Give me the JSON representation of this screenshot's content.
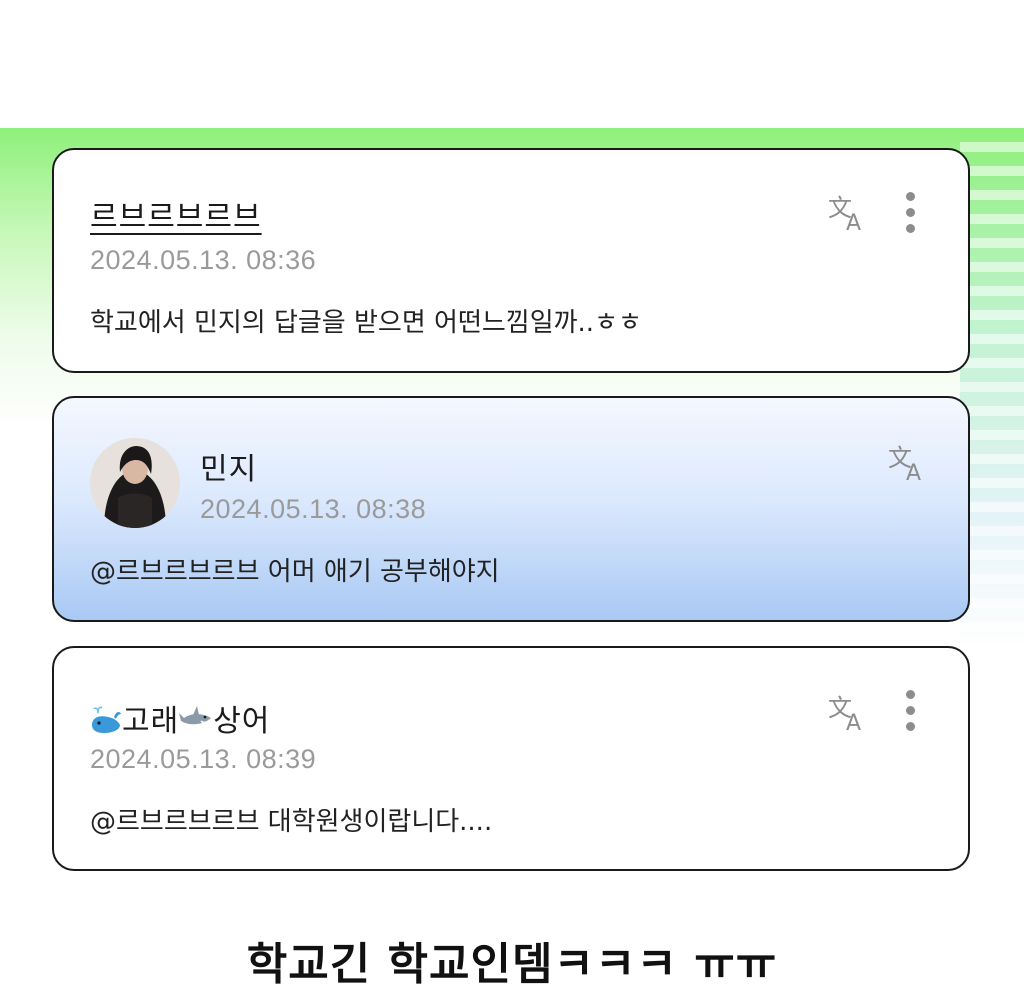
{
  "comments": [
    {
      "author": "르브르브르브",
      "timestamp": "2024.05.13. 08:36",
      "text": "학교에서 민지의 답글을 받으면 어떤느낌일까..ㅎㅎ",
      "icons": [
        "translate-icon",
        "more-vertical-icon"
      ]
    },
    {
      "author": "민지",
      "timestamp": "2024.05.13. 08:38",
      "mention": "@르브르브르브",
      "text": "어머 애기 공부해야지",
      "icons": [
        "avatar",
        "translate-icon"
      ]
    },
    {
      "author_part1": "고래",
      "author_part2": "상어",
      "timestamp": "2024.05.13. 08:39",
      "mention": "@르브르브르브",
      "text": "대학원생이랍니다....",
      "icons": [
        "whale-emoji-icon",
        "shark-emoji-icon",
        "translate-icon",
        "more-vertical-icon"
      ]
    }
  ],
  "caption": "학교긴 학교인뎀ㅋㅋㅋ ㅠㅠ",
  "colors": {
    "highlight_card_top": "#f4f8ff",
    "highlight_card_bottom": "#a9c9f4",
    "green_band": "#8ef07a",
    "timestamp": "#9a9a9a"
  }
}
